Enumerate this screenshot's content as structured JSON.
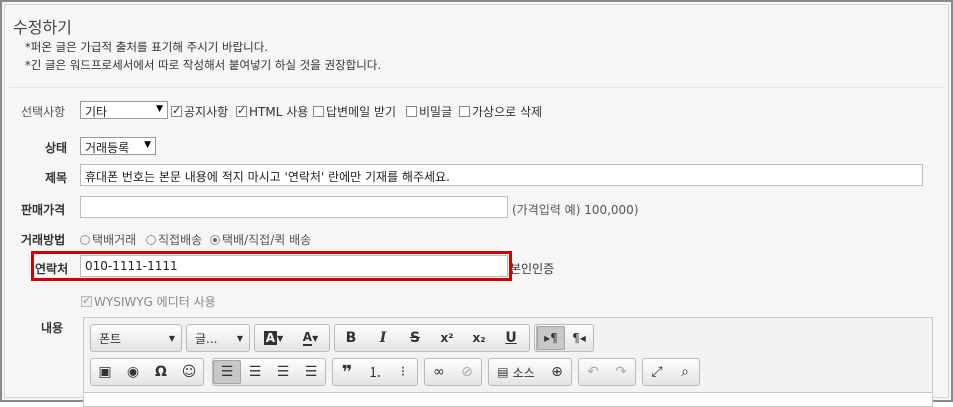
{
  "header": {
    "title": "수정하기",
    "notice1": "*퍼온 글은 가급적 출처를 표기해 주시기 바랍니다.",
    "notice2": "*긴 글은 워드프로세서에서 따로 작성해서 붙여넣기 하실 것을 권장합니다."
  },
  "form": {
    "options": {
      "label": "선택사항",
      "category_value": "기타",
      "checkboxes": [
        {
          "label": "공지사항",
          "checked": true
        },
        {
          "label": "HTML 사용",
          "checked": true
        },
        {
          "label": "답변메일 받기",
          "checked": false
        },
        {
          "label": "비밀글",
          "checked": false
        },
        {
          "label": "가상으로 삭제",
          "checked": false
        }
      ]
    },
    "status": {
      "label": "상태",
      "value": "거래등록"
    },
    "subject": {
      "label": "제목",
      "value": "휴대폰 번호는 본문 내용에 적지 마시고 '연락처' 란에만 기재를 해주세요."
    },
    "price": {
      "label": "판매가격",
      "value": "",
      "hint": "(가격입력 예) 100,000)"
    },
    "method": {
      "label": "거래방법",
      "options": [
        {
          "label": "택배거래",
          "selected": false
        },
        {
          "label": "직접배송",
          "selected": false
        },
        {
          "label": "택배/직접/퀵 배송",
          "selected": true
        }
      ]
    },
    "contact": {
      "label": "연락처",
      "value": "010-1111-1111",
      "verify_label": "본인인증"
    },
    "wysiwyg": {
      "label": "WYSIWYG 에디터 사용",
      "checked": true,
      "disabled": true
    },
    "content": {
      "label": "내용"
    }
  },
  "editor": {
    "font_label": "폰트",
    "size_label": "글...",
    "source_label": "소스",
    "colors": {
      "highlight": "#d20000"
    }
  }
}
